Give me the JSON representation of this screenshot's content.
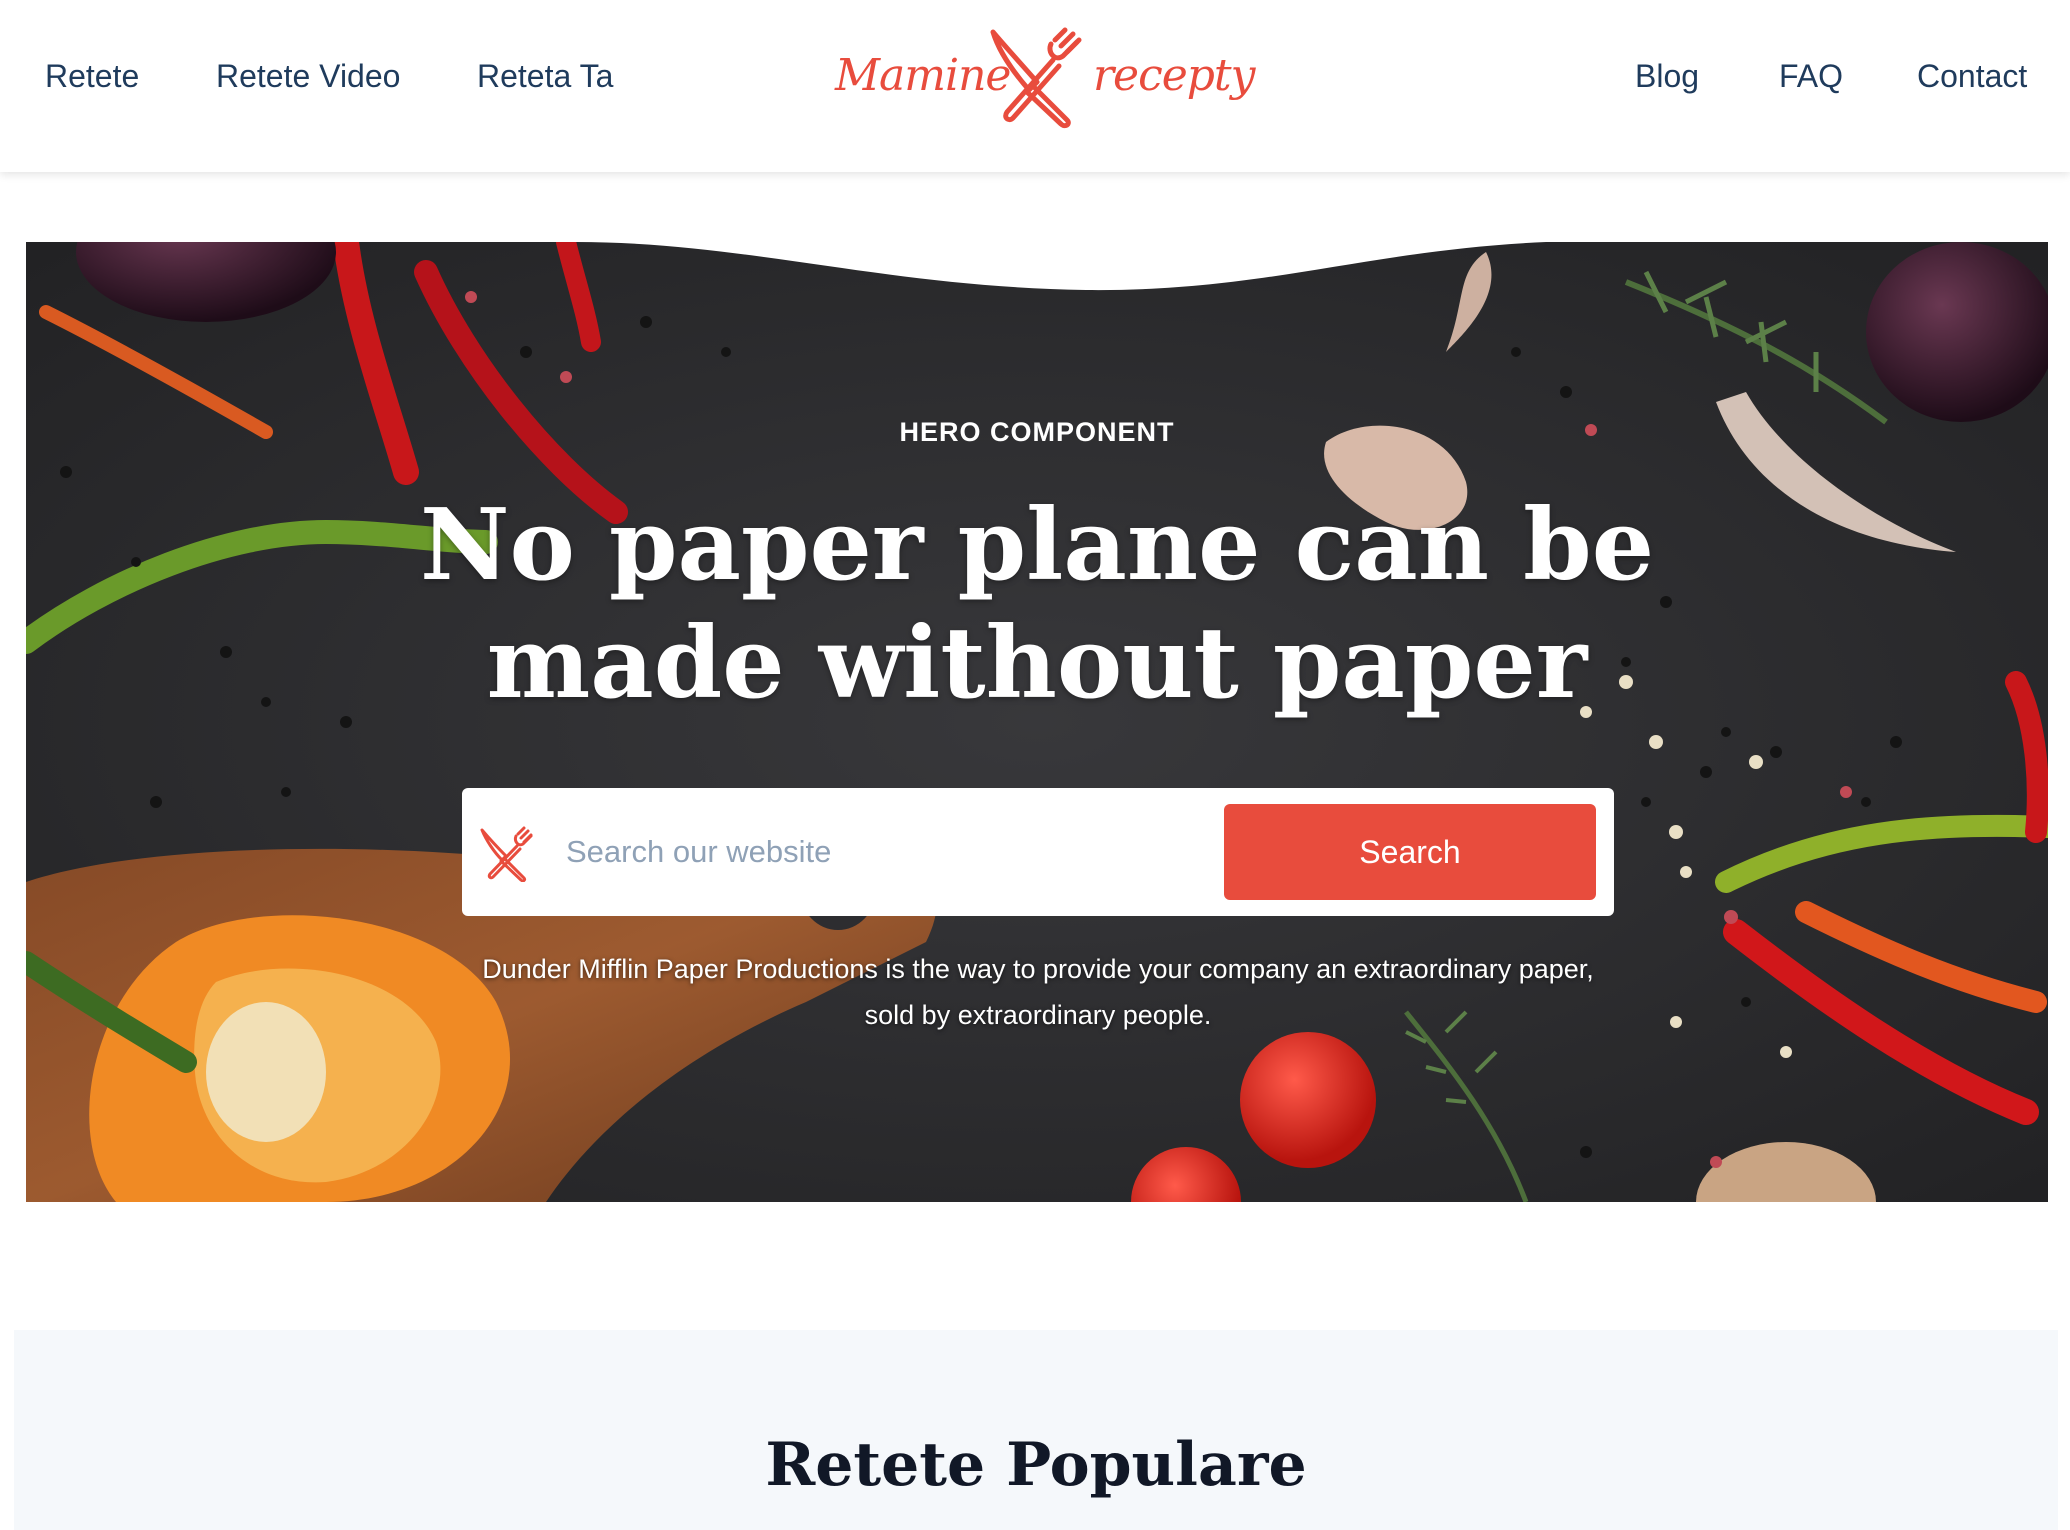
{
  "nav": {
    "left": [
      "Retete",
      "Retete Video",
      "Reteta Ta"
    ],
    "right": [
      "Blog",
      "FAQ",
      "Contact"
    ]
  },
  "logo": {
    "word_left": "Mamine",
    "word_right": "recepty"
  },
  "hero": {
    "eyebrow": "HERO COMPONENT",
    "title_line1": "No paper plane can be",
    "title_line2": "made without paper",
    "search_placeholder": "Search our website",
    "search_button": "Search",
    "description": "Dunder Mifflin Paper Productions is the way to provide your company an extraordinary paper, sold by extraordinary people."
  },
  "popular": {
    "title": "Retete Populare"
  },
  "colors": {
    "accent": "#e84c3d",
    "nav_text": "#1f3b5c",
    "hero_bg": "#2d2d30",
    "section_bg": "#f5f8fb"
  },
  "icons": [
    "fork-knife-icon"
  ]
}
